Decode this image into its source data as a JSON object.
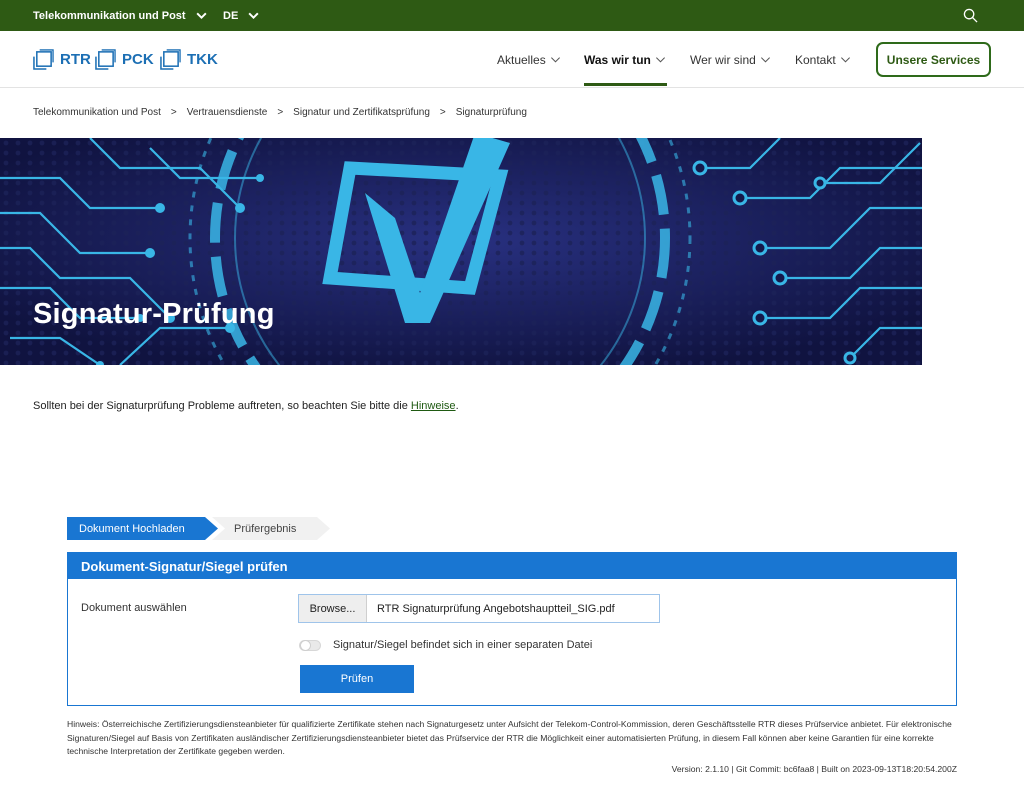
{
  "topbar": {
    "section_label": "Telekommunikation und Post",
    "language_label": "DE"
  },
  "logos": [
    {
      "label": "RTR"
    },
    {
      "label": "PCK"
    },
    {
      "label": "TKK"
    }
  ],
  "nav": {
    "items": [
      {
        "label": "Aktuelles",
        "active": false
      },
      {
        "label": "Was wir tun",
        "active": true
      },
      {
        "label": "Wer wir sind",
        "active": false
      },
      {
        "label": "Kontakt",
        "active": false
      }
    ],
    "services_button": "Unsere Services"
  },
  "breadcrumb": {
    "items": [
      "Telekommunikation und Post",
      "Vertrauensdienste",
      "Signatur und Zertifikatsprüfung",
      "Signaturprüfung"
    ],
    "separator": ">"
  },
  "hero": {
    "title": "Signatur-Prüfung"
  },
  "intro": {
    "text_before": "Sollten bei der Signaturprüfung Probleme auftreten, so beachten Sie bitte die",
    "link": "Hinweise",
    "text_after": "."
  },
  "steps": [
    {
      "label": "Dokument Hochladen",
      "active": true
    },
    {
      "label": "Prüfergebnis",
      "active": false
    }
  ],
  "form": {
    "title": "Dokument-Signatur/Siegel prüfen",
    "field_label": "Dokument auswählen",
    "browse_label": "Browse...",
    "file_name": "RTR Signaturprüfung Angebotshauptteil_SIG.pdf",
    "toggle_label": "Signatur/Siegel befindet sich in einer separaten Datei",
    "toggle_on": false,
    "submit_label": "Prüfen"
  },
  "hint": {
    "text": "Hinweis: Österreichische Zertifizierungsdiensteanbieter für qualifizierte Zertifikate stehen nach Signaturgesetz unter Aufsicht der Telekom-Control-Kommission, deren Geschäftsstelle RTR dieses Prüfservice anbietet. Für elektronische Signaturen/Siegel auf Basis von Zertifikaten ausländischer Zertifizierungsdiensteanbieter bietet das Prüfservice der RTR die Möglichkeit einer automatisierten Prüfung, in diesem Fall können aber keine Garantien für eine korrekte technische Interpretation der Zertifikate gegeben werden."
  },
  "version": "Version: 2.1.10 | Git Commit: bc6faa8 | Built on 2023-09-13T18:20:54.200Z",
  "colors": {
    "brand_green": "#2e5a14",
    "primary_blue": "#1976d2",
    "logo_blue": "#1c6fb4",
    "hero_navy": "#15194a",
    "hero_cyan": "#39b6e6"
  }
}
